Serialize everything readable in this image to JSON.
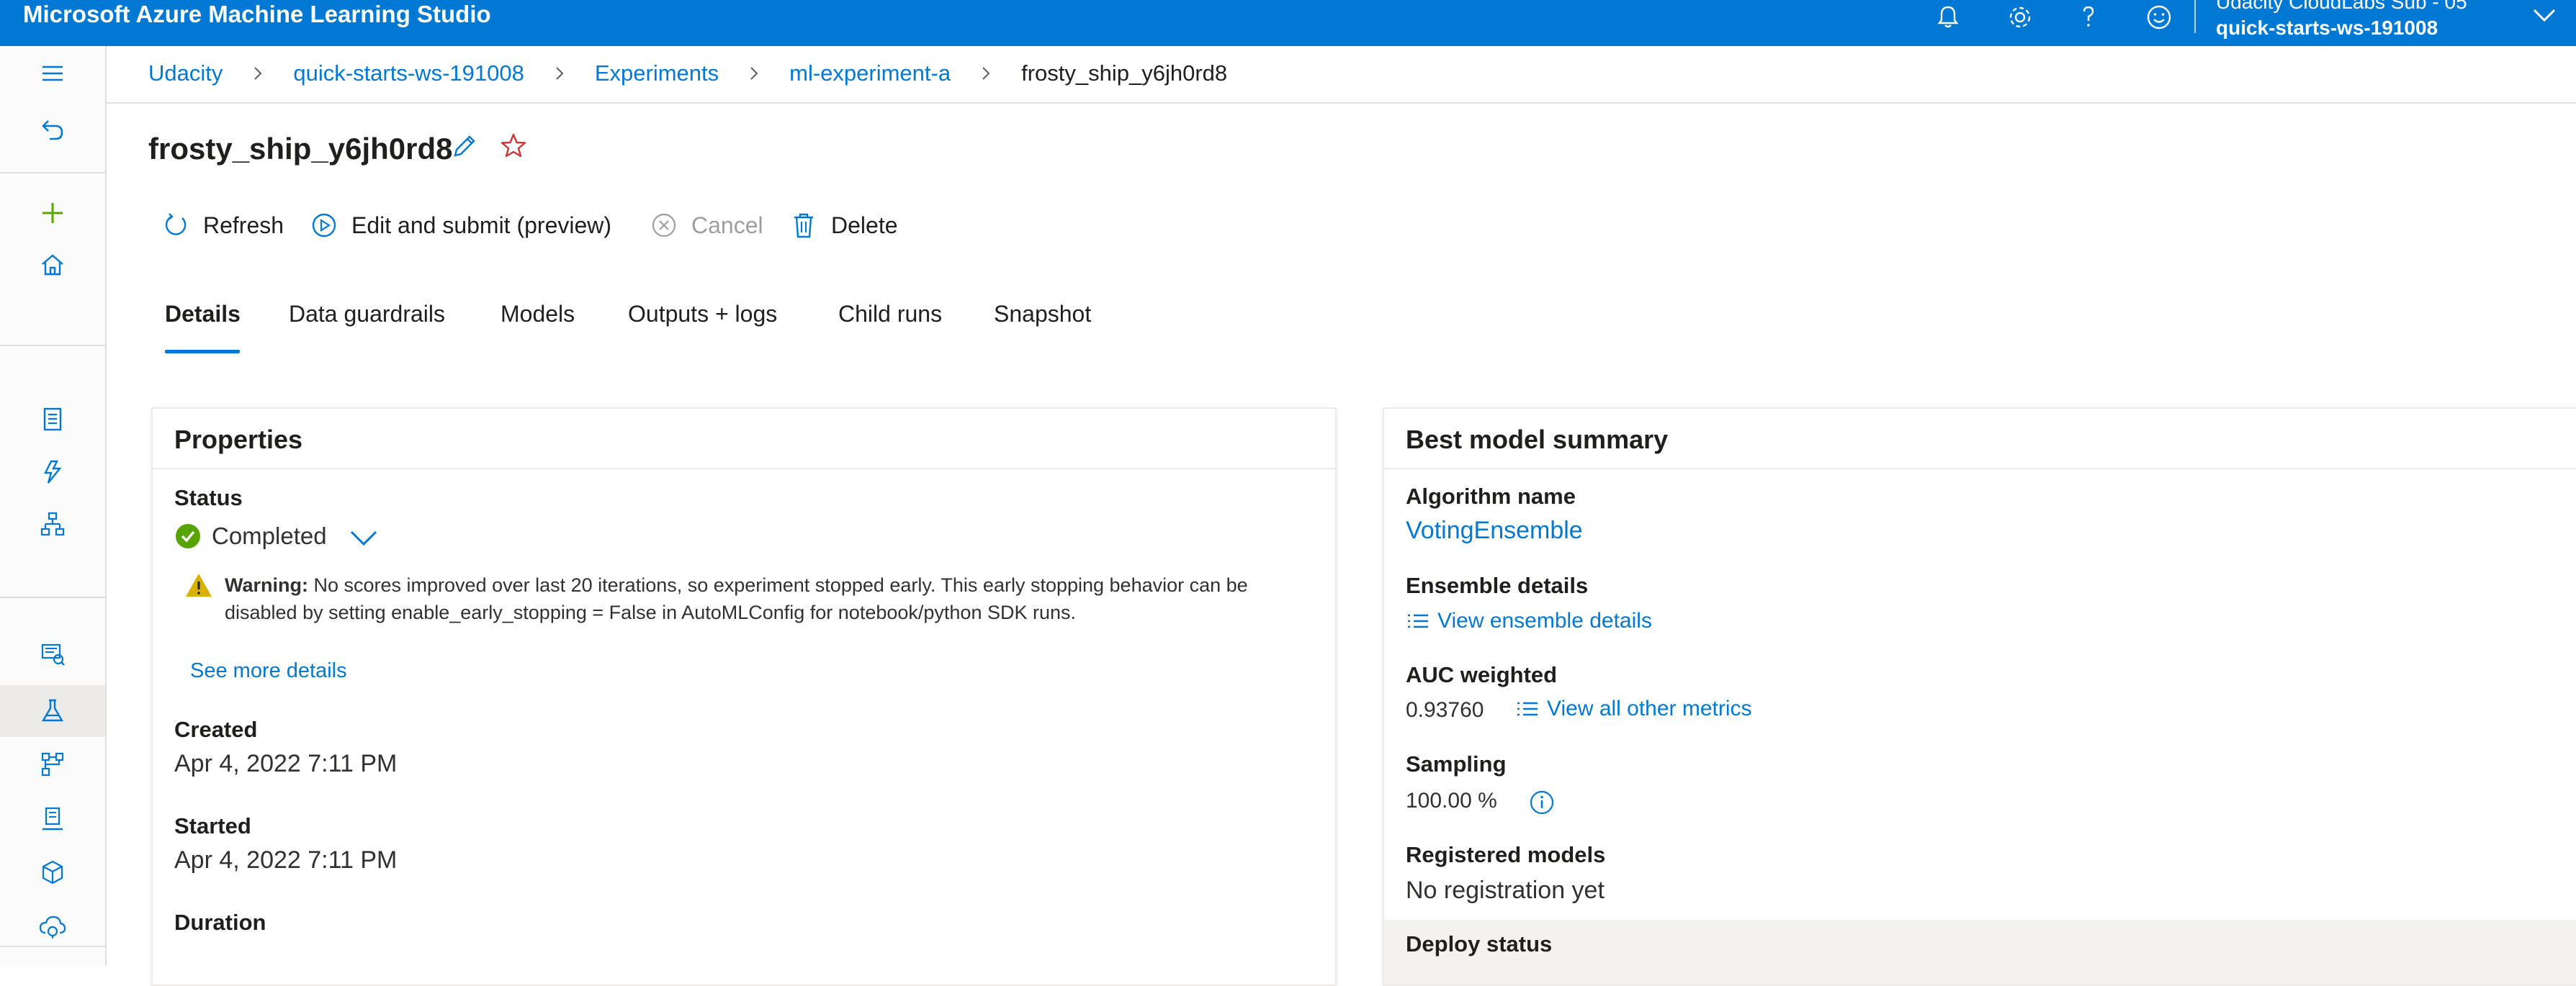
{
  "app": {
    "title": "Microsoft Azure Machine Learning Studio",
    "account_name": "Udacity CloudLabs Sub - 05",
    "workspace": "quick-starts-ws-191008"
  },
  "colors": {
    "brand": "#0078d4",
    "success": "#57a300",
    "warning": "#d7b200",
    "star": "#d13438"
  },
  "topbar_icons": [
    "bell-icon",
    "gear-icon",
    "help-icon",
    "feedback-smiley-icon",
    "chevron-down-icon"
  ],
  "breadcrumb": {
    "items": [
      "Udacity",
      "quick-starts-ws-191008",
      "Experiments",
      "ml-experiment-a"
    ],
    "current": "frosty_ship_y6jh0rd8"
  },
  "run": {
    "title": "frosty_ship_y6jh0rd8"
  },
  "toolbar": {
    "refresh": "Refresh",
    "edit_submit": "Edit and submit (preview)",
    "cancel": "Cancel",
    "delete": "Delete"
  },
  "tabs": [
    "Details",
    "Data guardrails",
    "Models",
    "Outputs + logs",
    "Child runs",
    "Snapshot"
  ],
  "active_tab": "Details",
  "properties": {
    "title": "Properties",
    "status_label": "Status",
    "status_value": "Completed",
    "warning_prefix": "Warning:",
    "warning_line1": "No scores improved over last 20 iterations, so experiment stopped early. This early stopping behavior can be",
    "warning_line2": "disabled by setting enable_early_stopping = False in AutoMLConfig for notebook/python SDK runs.",
    "see_more": "See more details",
    "created_label": "Created",
    "created_value": "Apr 4, 2022 7:11 PM",
    "started_label": "Started",
    "started_value": "Apr 4, 2022 7:11 PM",
    "duration_label": "Duration"
  },
  "best_model": {
    "title": "Best model summary",
    "algorithm_label": "Algorithm name",
    "algorithm_value": "VotingEnsemble",
    "ensemble_label": "Ensemble details",
    "ensemble_link": "View ensemble details",
    "auc_label": "AUC weighted",
    "auc_value": "0.93760",
    "metrics_link": "View all other metrics",
    "sampling_label": "Sampling",
    "sampling_value": "100.00 %",
    "registered_label": "Registered models",
    "registered_value": "No registration yet",
    "deploy_label": "Deploy status"
  }
}
